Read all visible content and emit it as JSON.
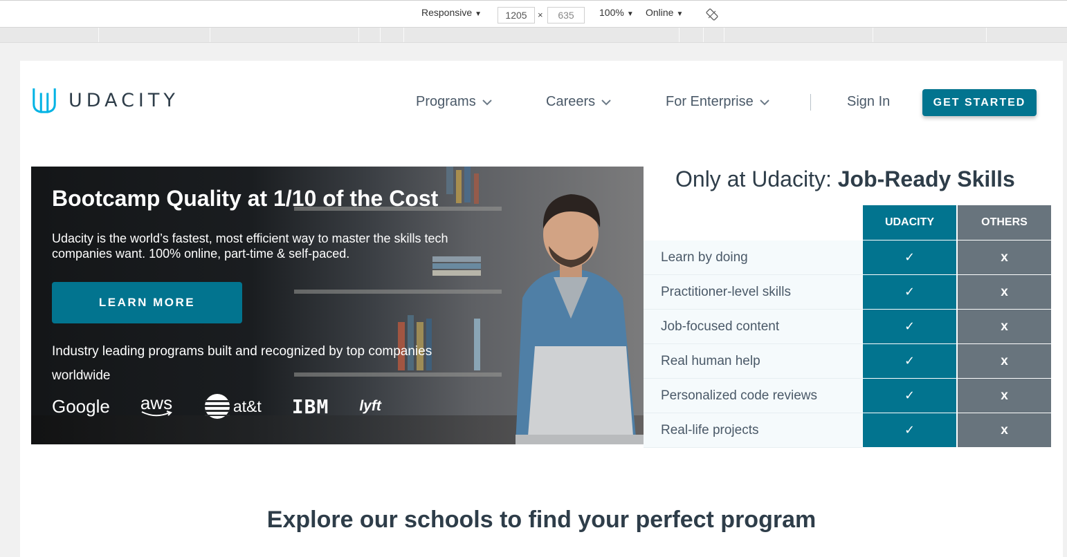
{
  "devtools": {
    "device": "Responsive",
    "width": "1205",
    "height": "635",
    "times": "×",
    "zoom": "100%",
    "network": "Online"
  },
  "header": {
    "logo_text": "UDACITY",
    "nav": [
      "Programs",
      "Careers",
      "For Enterprise"
    ],
    "sign_in": "Sign In",
    "get_started": "GET STARTED"
  },
  "hero": {
    "title": "Bootcamp Quality at 1/10 of the Cost",
    "text": "Udacity is the world’s fastest, most efficient way to master the skills tech companies want. 100% online, part-time & self-paced.",
    "cta": "LEARN MORE",
    "subtext": "Industry leading programs built and recognized by top companies worldwide",
    "brands": [
      "Google",
      "aws",
      "at&t",
      "IBM",
      "lyft"
    ]
  },
  "comparison": {
    "title_plain": "Only at Udacity: ",
    "title_bold": "Job-Ready Skills",
    "col_udacity": "UDACITY",
    "col_others": "OTHERS",
    "check": "✓",
    "cross": "x",
    "rows": [
      "Learn by doing",
      "Practitioner-level skills",
      "Job-focused content",
      "Real human help",
      "Personalized code reviews",
      "Real-life projects"
    ]
  },
  "explore": "Explore our schools to find your perfect program",
  "colors": {
    "teal": "#02748f",
    "gray_col": "#68747d",
    "text_dark": "#2e3d49",
    "logo_blue": "#02b3e4"
  }
}
